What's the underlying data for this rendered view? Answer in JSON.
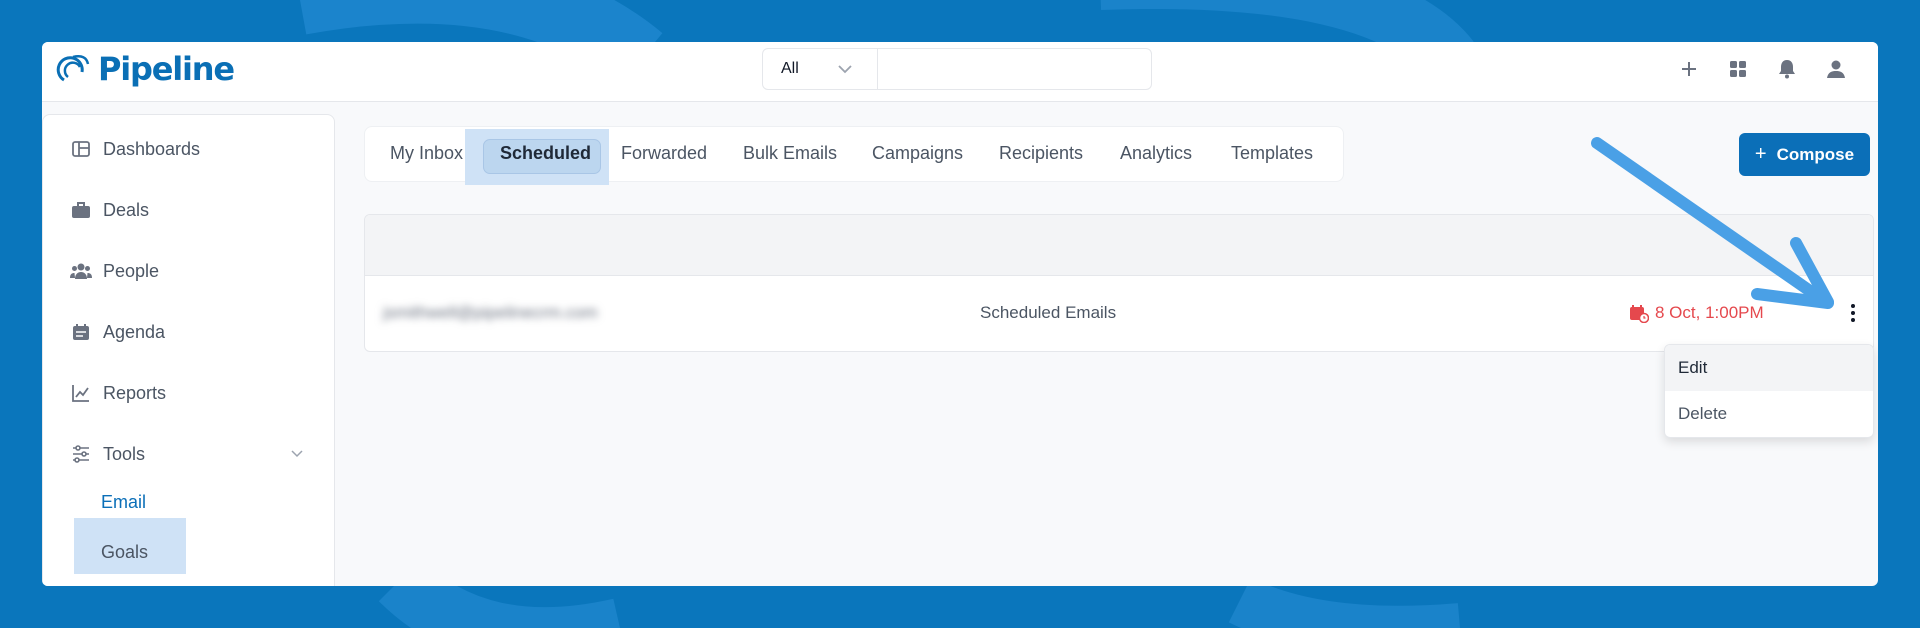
{
  "app": {
    "name": "Pipeline"
  },
  "search": {
    "scope": "All",
    "placeholder": ""
  },
  "topbar_icons": [
    "plus-icon",
    "apps-grid-icon",
    "bell-icon",
    "user-icon"
  ],
  "sidebar": {
    "items": [
      {
        "label": "Dashboards",
        "icon": "dashboard-icon"
      },
      {
        "label": "Deals",
        "icon": "briefcase-icon"
      },
      {
        "label": "People",
        "icon": "people-icon"
      },
      {
        "label": "Agenda",
        "icon": "calendar-icon"
      },
      {
        "label": "Reports",
        "icon": "chart-line-icon"
      },
      {
        "label": "Tools",
        "icon": "sliders-icon"
      }
    ],
    "subitems": [
      {
        "label": "Email",
        "active": true
      },
      {
        "label": "Goals",
        "active": false
      }
    ]
  },
  "tabs": [
    {
      "label": "My Inbox"
    },
    {
      "label": "Scheduled",
      "active": true
    },
    {
      "label": "Forwarded"
    },
    {
      "label": "Bulk Emails"
    },
    {
      "label": "Campaigns"
    },
    {
      "label": "Recipients"
    },
    {
      "label": "Analytics"
    },
    {
      "label": "Templates"
    }
  ],
  "compose": {
    "label": "Compose"
  },
  "rows": [
    {
      "email": "jsmithwell@pipelinecrm.com",
      "type": "Scheduled Emails",
      "scheduled_at": "8 Oct, 1:00PM"
    }
  ],
  "row_menu": {
    "items": [
      "Edit",
      "Delete"
    ]
  },
  "colors": {
    "brand": "#0a6fb5",
    "background": "#0a76bc",
    "highlight": "#cfe2f6",
    "date_red": "#e5484d",
    "arrow": "#4aa0e6"
  }
}
